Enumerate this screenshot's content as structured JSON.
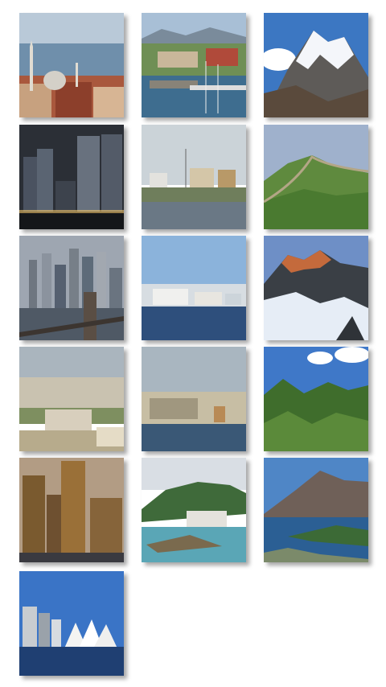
{
  "gallery": {
    "items": [
      {
        "subject": "istanbul-city-skyline"
      },
      {
        "subject": "harbor-town"
      },
      {
        "subject": "snowy-mountain-peak"
      },
      {
        "subject": "night-skyscrapers"
      },
      {
        "subject": "coastal-town-waterfront"
      },
      {
        "subject": "great-wall-hills"
      },
      {
        "subject": "city-skyline-bridge"
      },
      {
        "subject": "waterfront-houses"
      },
      {
        "subject": "alpine-peaks-sunset"
      },
      {
        "subject": "paris-cityscape"
      },
      {
        "subject": "coastal-fortress-town"
      },
      {
        "subject": "green-mountains-sky"
      },
      {
        "subject": "golden-hour-towers"
      },
      {
        "subject": "tropical-bay-resort"
      },
      {
        "subject": "lake-and-mountain"
      },
      {
        "subject": "sydney-opera-house"
      }
    ]
  }
}
